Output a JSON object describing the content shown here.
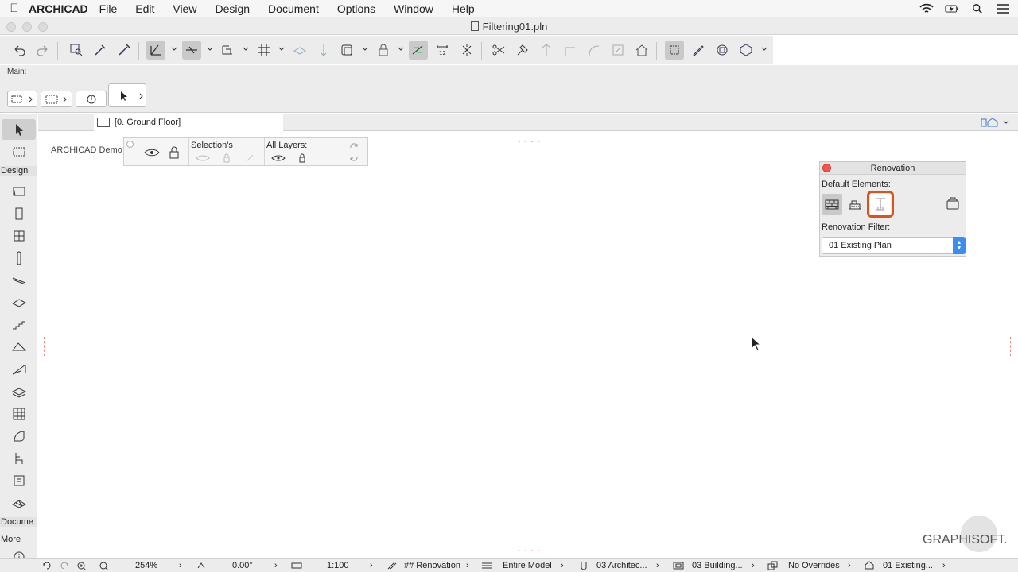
{
  "menubar": {
    "app_name": "ARCHICAD",
    "items": [
      "File",
      "Edit",
      "View",
      "Design",
      "Document",
      "Options",
      "Window",
      "Help"
    ]
  },
  "window": {
    "title": "Filtering01.pln"
  },
  "info_box": {
    "label": "Main:"
  },
  "toolbox": {
    "design_label": "Design",
    "document_label": "Docume",
    "more_label": "More"
  },
  "tab": {
    "label": "[0. Ground Floor]"
  },
  "quick_options": {
    "project": "ARCHICAD Demo",
    "selection_label": "Selection's",
    "all_layers_label": "All Layers:"
  },
  "renovation": {
    "title": "Renovation",
    "default_elements_label": "Default Elements:",
    "filter_label": "Renovation Filter:",
    "filter_value": "01 Existing Plan"
  },
  "status": {
    "zoom": "254%",
    "angle": "0.00°",
    "scale": "1:100",
    "renovation": "## Renovation",
    "model": "Entire Model",
    "layer_combo": "03 Architec...",
    "model_view": "03 Building...",
    "overrides": "No Overrides",
    "filter": "01 Existing..."
  },
  "branding": {
    "logo": "GRAPHISOFT."
  },
  "colors": {
    "highlight": "#d9531e",
    "close_button": "#f3534b",
    "stepper": "#3b8df0"
  }
}
